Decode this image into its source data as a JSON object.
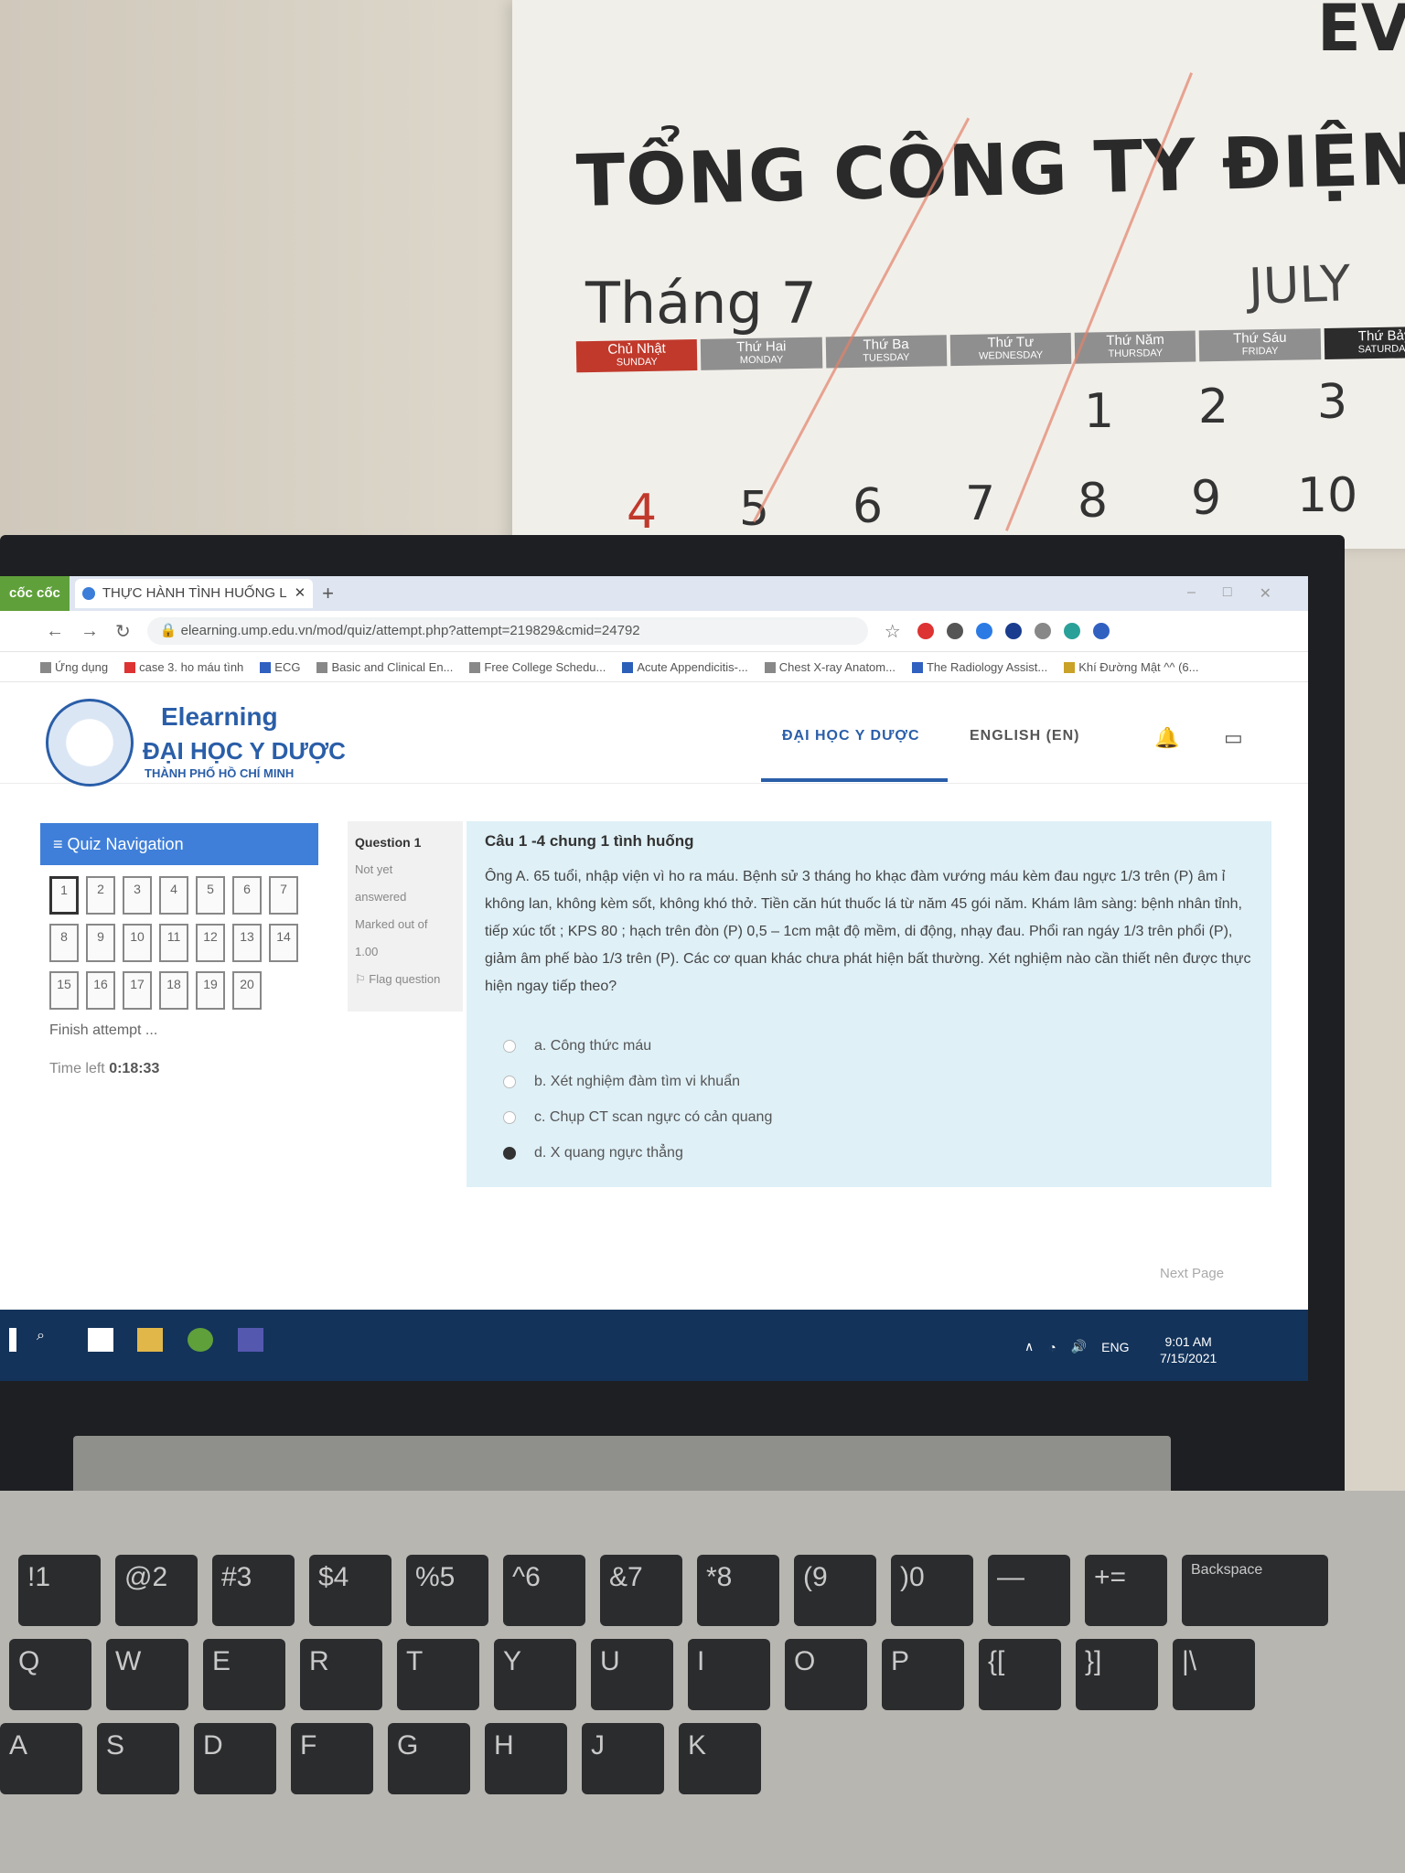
{
  "calendar": {
    "brand_corner": "EV",
    "company": "TỔNG CÔNG TY ĐIỆN LỰ",
    "month_vi": "Tháng 7",
    "month_en": "JULY",
    "days": [
      {
        "vi": "Chủ Nhật",
        "en": "SUNDAY"
      },
      {
        "vi": "Thứ Hai",
        "en": "MONDAY"
      },
      {
        "vi": "Thứ Ba",
        "en": "TUESDAY"
      },
      {
        "vi": "Thứ Tư",
        "en": "WEDNESDAY"
      },
      {
        "vi": "Thứ Năm",
        "en": "THURSDAY"
      },
      {
        "vi": "Thứ Sáu",
        "en": "FRIDAY"
      },
      {
        "vi": "Thứ Bảy",
        "en": "SATURDAY"
      }
    ],
    "row1": [
      "1",
      "2",
      "3"
    ],
    "row2": [
      "4",
      "5",
      "6",
      "7",
      "8",
      "9",
      "10"
    ]
  },
  "browser": {
    "brand": "cốc cốc",
    "tab_title": "THỰC HÀNH TÌNH HUỐNG L",
    "url": "elearning.ump.edu.vn/mod/quiz/attempt.php?attempt=219829&cmid=24792",
    "bookmarks": [
      "Ứng dụng",
      "case 3. ho máu tình",
      "ECG",
      "Basic and Clinical En...",
      "Free College Schedu...",
      "Acute Appendicitis-...",
      "Chest X-ray Anatom...",
      "The Radiology Assist...",
      "Khí Đường Mật ^^ (6..."
    ]
  },
  "site": {
    "logo_title": "Elearning",
    "logo_uni": "ĐẠI HỌC Y DƯỢC",
    "logo_city": "THÀNH PHỐ HỒ CHÍ MINH",
    "nav_uni": "ĐẠI HỌC Y DƯỢC",
    "nav_lang": "ENGLISH (EN)"
  },
  "quiz": {
    "nav_title": "Quiz Navigation",
    "buttons": [
      "1",
      "2",
      "3",
      "4",
      "5",
      "6",
      "7",
      "8",
      "9",
      "10",
      "11",
      "12",
      "13",
      "14",
      "15",
      "16",
      "17",
      "18",
      "19",
      "20"
    ],
    "finish": "Finish attempt ...",
    "time_label": "Time left",
    "time_value": "0:18:33",
    "question_label": "Question",
    "question_no": "1",
    "status1": "Not yet",
    "status2": "answered",
    "marked1": "Marked out of",
    "marked2": "1.00",
    "flag": "Flag question",
    "title": "Câu 1 -4 chung 1 tình huống",
    "text": "Ông A. 65 tuổi, nhập viện vì ho ra máu. Bệnh sử 3 tháng ho khạc đàm vướng máu kèm đau ngực 1/3 trên (P) âm ỉ không lan, không kèm sốt, không khó thở. Tiền căn hút thuốc lá từ năm 45 gói năm. Khám lâm sàng: bệnh nhân tỉnh, tiếp xúc tốt ; KPS 80 ; hạch trên đòn (P) 0,5 – 1cm mật độ mềm, di động, nhạy đau. Phổi ran ngáy 1/3 trên phổi (P), giảm âm phế bào 1/3 trên (P). Các cơ quan khác chưa phát hiện bất thường. Xét nghiệm nào cần thiết nên được thực hiện ngay tiếp theo?",
    "answers": [
      {
        "label": "a. Công thức máu",
        "selected": false
      },
      {
        "label": "b. Xét nghiệm đàm tìm vi khuẩn",
        "selected": false
      },
      {
        "label": "c. Chụp CT scan ngực có cản quang",
        "selected": false
      },
      {
        "label": "d. X quang ngực thẳng",
        "selected": true
      }
    ],
    "next": "Next Page"
  },
  "taskbar": {
    "lang": "ENG",
    "time": "9:01 AM",
    "date": "7/15/2021"
  },
  "keyboard": {
    "row_num": [
      "!1",
      "@2",
      "#3",
      "$4",
      "%5",
      "^6",
      "&7",
      "*8",
      "(9",
      ")0",
      "—",
      "+=",
      "Backspace"
    ],
    "row_q": [
      "Q",
      "W",
      "E",
      "R",
      "T",
      "Y",
      "U",
      "I",
      "O",
      "P",
      "{[",
      "}]",
      "|\\"
    ],
    "row_a": [
      "A",
      "S",
      "D",
      "F",
      "G",
      "H",
      "J",
      "K"
    ]
  }
}
